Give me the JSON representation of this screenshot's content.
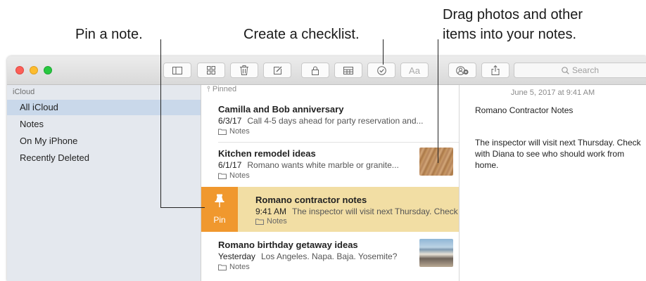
{
  "callouts": {
    "pin": "Pin a note.",
    "checklist": "Create a checklist.",
    "drag_line1": "Drag photos and other",
    "drag_line2": "items into your notes."
  },
  "toolbar": {
    "format_label": "Aa",
    "search_placeholder": "Search",
    "icons": [
      "sidebar-icon",
      "gallery-icon",
      "trash-icon",
      "compose-icon",
      "lock-icon",
      "table-icon",
      "checklist-icon",
      "format-icon",
      "add-people-icon",
      "share-icon",
      "search-icon"
    ]
  },
  "sidebar": {
    "header": "iCloud",
    "items": [
      {
        "label": "All iCloud",
        "selected": true
      },
      {
        "label": "Notes"
      },
      {
        "label": "On My iPhone"
      },
      {
        "label": "Recently Deleted"
      }
    ]
  },
  "list": {
    "pinned_label": "Pinned",
    "notes": [
      {
        "title": "Camilla and Bob anniversary",
        "date": "6/3/17",
        "snippet": "Call 4-5 days ahead for party reservation and...",
        "folder": "Notes"
      },
      {
        "title": "Kitchen remodel ideas",
        "date": "6/1/17",
        "snippet": "Romano wants white marble or granite...",
        "folder": "Notes",
        "thumbnail": "wood-floor"
      },
      {
        "title": "Romano contractor notes",
        "date": "9:41 AM",
        "snippet": "The inspector will visit next Thursday. Check",
        "folder": "Notes",
        "pin_action": "Pin",
        "highlighted": true
      },
      {
        "title": "Romano birthday getaway ideas",
        "date": "Yesterday",
        "snippet": "Los Angeles. Napa. Baja. Yosemite?",
        "folder": "Notes",
        "thumbnail": "beach-rocks"
      }
    ]
  },
  "detail": {
    "timestamp": "June 5, 2017 at 9:41 AM",
    "title": "Romano Contractor Notes",
    "body": "The inspector will visit next Thursday. Check with Diana to see who should work from home."
  },
  "colors": {
    "accent_swipe": "#f0982e",
    "highlight_row": "#f2dea4",
    "sidebar_bg": "#e4e8ee",
    "sidebar_selected": "#c9d8ea"
  }
}
